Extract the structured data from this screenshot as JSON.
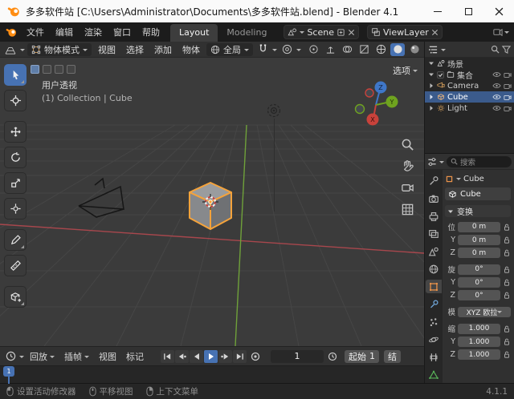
{
  "titlebar": {
    "title": "多多软件站 [C:\\Users\\Administrator\\Documents\\多多软件站.blend] - Blender 4.1"
  },
  "topbar": {
    "menus": [
      "文件",
      "编辑",
      "渲染",
      "窗口",
      "帮助"
    ],
    "workspaces": [
      "Layout",
      "Modeling"
    ],
    "scene": {
      "label": "Scene"
    },
    "viewlayer": {
      "label": "ViewLayer"
    }
  },
  "viewport_header": {
    "mode": "物体模式",
    "menus": [
      "视图",
      "选择",
      "添加",
      "物体"
    ],
    "orientation": "全局",
    "options_label": "选项"
  },
  "viewport": {
    "view_label": "用户透视",
    "context_label": "(1) Collection | Cube",
    "gizmo": {
      "x": "X",
      "y": "Y",
      "z": "Z"
    }
  },
  "outliner": {
    "rows": [
      {
        "label": "场景"
      },
      {
        "label": "集合"
      },
      {
        "label": "Camera"
      },
      {
        "label": "Cube"
      },
      {
        "label": "Light"
      }
    ]
  },
  "properties": {
    "search_placeholder": "搜索",
    "breadcrumb": "Cube",
    "object_name": "Cube",
    "transform": {
      "title": "变换",
      "rows": [
        {
          "label": "位",
          "value": "0 m"
        },
        {
          "label": "Y",
          "value": "0 m"
        },
        {
          "label": "Z",
          "value": "0 m"
        },
        {
          "label": "旋",
          "value": "0°"
        },
        {
          "label": "Y",
          "value": "0°"
        },
        {
          "label": "Z",
          "value": "0°"
        },
        {
          "label": "模",
          "value": "XYZ 欧拉"
        },
        {
          "label": "缩",
          "value": "1.000"
        },
        {
          "label": "Y",
          "value": "1.000"
        },
        {
          "label": "Z",
          "value": "1.000"
        }
      ]
    }
  },
  "timeline": {
    "menus": [
      "回放",
      "插帧",
      "视图",
      "标记"
    ],
    "current_frame": "1",
    "start_label": "起始",
    "start_value": "1",
    "end_label": "结"
  },
  "statusbar": {
    "hints": [
      "设置活动修改器",
      "平移视图",
      "上下文菜单"
    ],
    "version": "4.1.1"
  },
  "colors": {
    "accent": "#4772b3",
    "selection_outline": "#f5a33b",
    "axis_x": "#a8474d",
    "axis_y": "#6fa13a",
    "axis_z": "#3f77c9"
  }
}
